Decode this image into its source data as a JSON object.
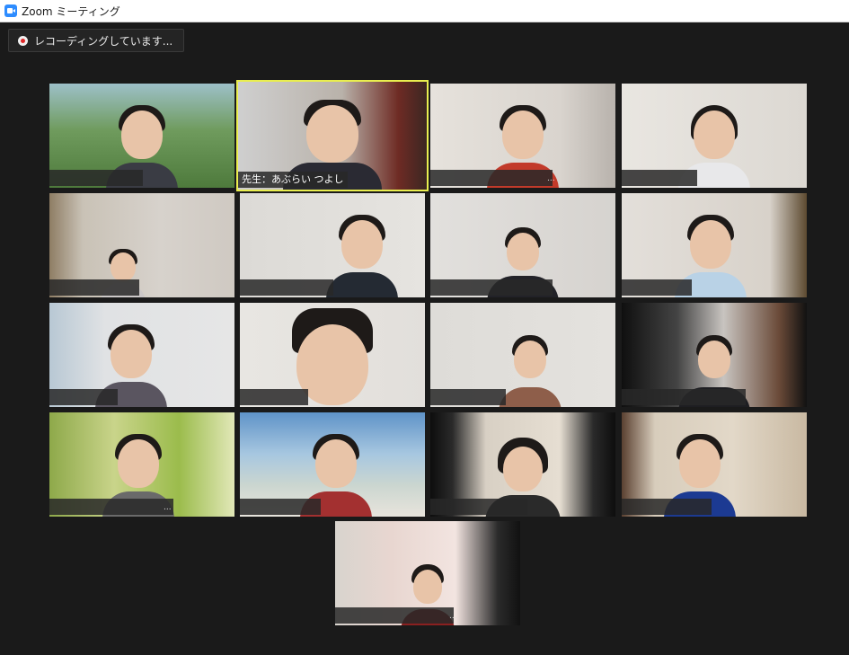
{
  "window": {
    "title": "Zoom ミーティング"
  },
  "recording": {
    "label": "レコーディングしています..."
  },
  "participants": {
    "host_name": "先生：あぶらい つよし",
    "more_options": "..."
  },
  "colors": {
    "active_speaker_border": "#e9ee4f",
    "background": "#1a1a1a",
    "recording_dot": "#e02828"
  }
}
